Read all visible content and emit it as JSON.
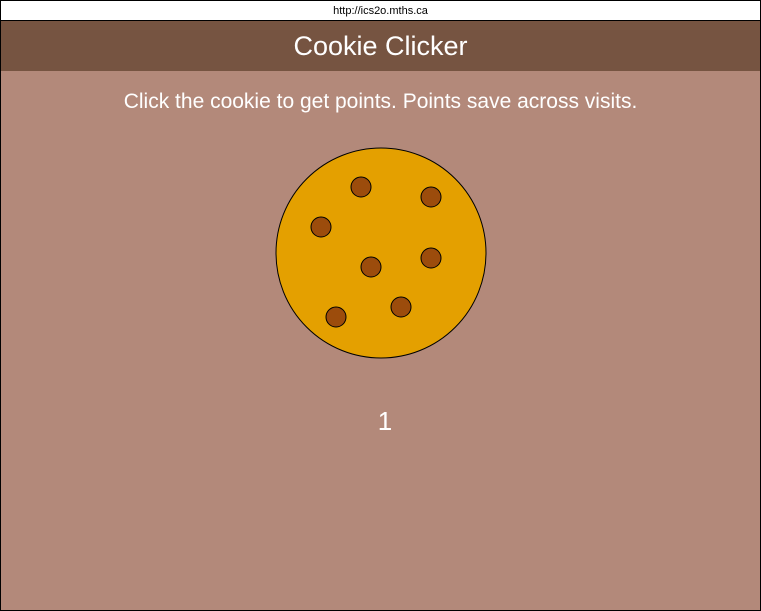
{
  "browser": {
    "url": "http://ics2o.mths.ca"
  },
  "header": {
    "title": "Cookie Clicker"
  },
  "main": {
    "instructions": "Click the cookie to get points. Points save across visits.",
    "score": "1"
  },
  "colors": {
    "background": "#b3897a",
    "header": "#765441",
    "cookie": "#e4a000",
    "chip": "#9c4c0c",
    "text": "#ffffff"
  },
  "icons": {
    "cookie": "cookie-icon",
    "chip": "chocolate-chip"
  }
}
